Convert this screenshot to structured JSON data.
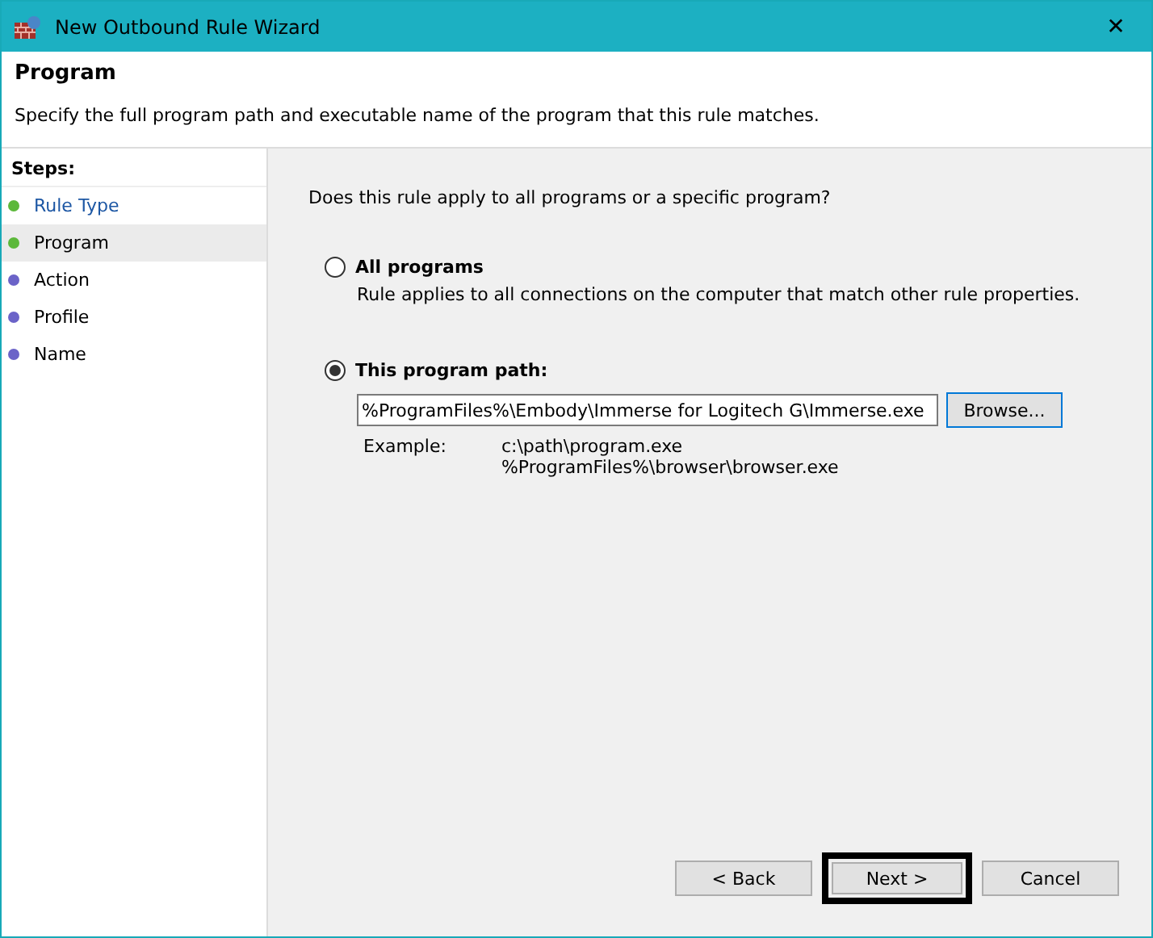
{
  "window": {
    "title": "New Outbound Rule Wizard",
    "close": "✕"
  },
  "header": {
    "title": "Program",
    "description": "Specify the full program path and executable name of the program that this rule matches."
  },
  "steps": {
    "title": "Steps:",
    "items": [
      {
        "label": "Rule Type",
        "done": true,
        "selected": false
      },
      {
        "label": "Program",
        "done": true,
        "selected": true
      },
      {
        "label": "Action",
        "done": false,
        "selected": false
      },
      {
        "label": "Profile",
        "done": false,
        "selected": false
      },
      {
        "label": "Name",
        "done": false,
        "selected": false
      }
    ]
  },
  "question": "Does this rule apply to all programs or a specific program?",
  "options": [
    {
      "label": "All programs",
      "description": "Rule applies to all connections on the computer that match other rule properties.",
      "selected": false
    },
    {
      "label": "This program path:",
      "selected": true
    }
  ],
  "path": {
    "value": "%ProgramFiles%\\Embody\\Immerse for Logitech G\\Immerse.exe",
    "browse": "Browse..."
  },
  "example": {
    "label": "Example:",
    "lines": [
      "c:\\path\\program.exe",
      "%ProgramFiles%\\browser\\browser.exe"
    ]
  },
  "buttons": [
    {
      "label": "< Back",
      "highlighted": false
    },
    {
      "label": "Next >",
      "highlighted": true
    },
    {
      "label": "Cancel",
      "highlighted": false
    }
  ]
}
